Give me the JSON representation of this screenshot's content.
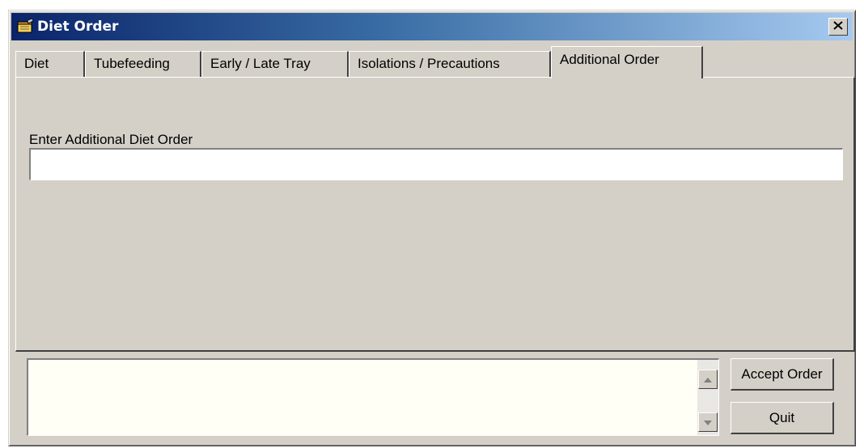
{
  "window": {
    "title": "Diet Order",
    "close_label": "×"
  },
  "tabs": [
    {
      "label": "Diet",
      "active": false
    },
    {
      "label": "Tubefeeding",
      "active": false
    },
    {
      "label": "Early / Late Tray",
      "active": false
    },
    {
      "label": "Isolations / Precautions",
      "active": false
    },
    {
      "label": "Additional Order",
      "active": true
    }
  ],
  "additional_order": {
    "label": "Enter Additional Diet Order",
    "value": "",
    "placeholder": ""
  },
  "summary": {
    "text": ""
  },
  "buttons": {
    "accept_label": "Accept Order",
    "quit_label": "Quit"
  },
  "icons": {
    "title": "notepad-icon",
    "close": "close-icon",
    "scroll_up": "arrow-up-icon",
    "scroll_down": "arrow-down-icon"
  },
  "colors": {
    "face": "#d4d0c8",
    "title_start": "#0a246a",
    "title_end": "#a6caf0",
    "memo_bg": "#fffff5"
  }
}
